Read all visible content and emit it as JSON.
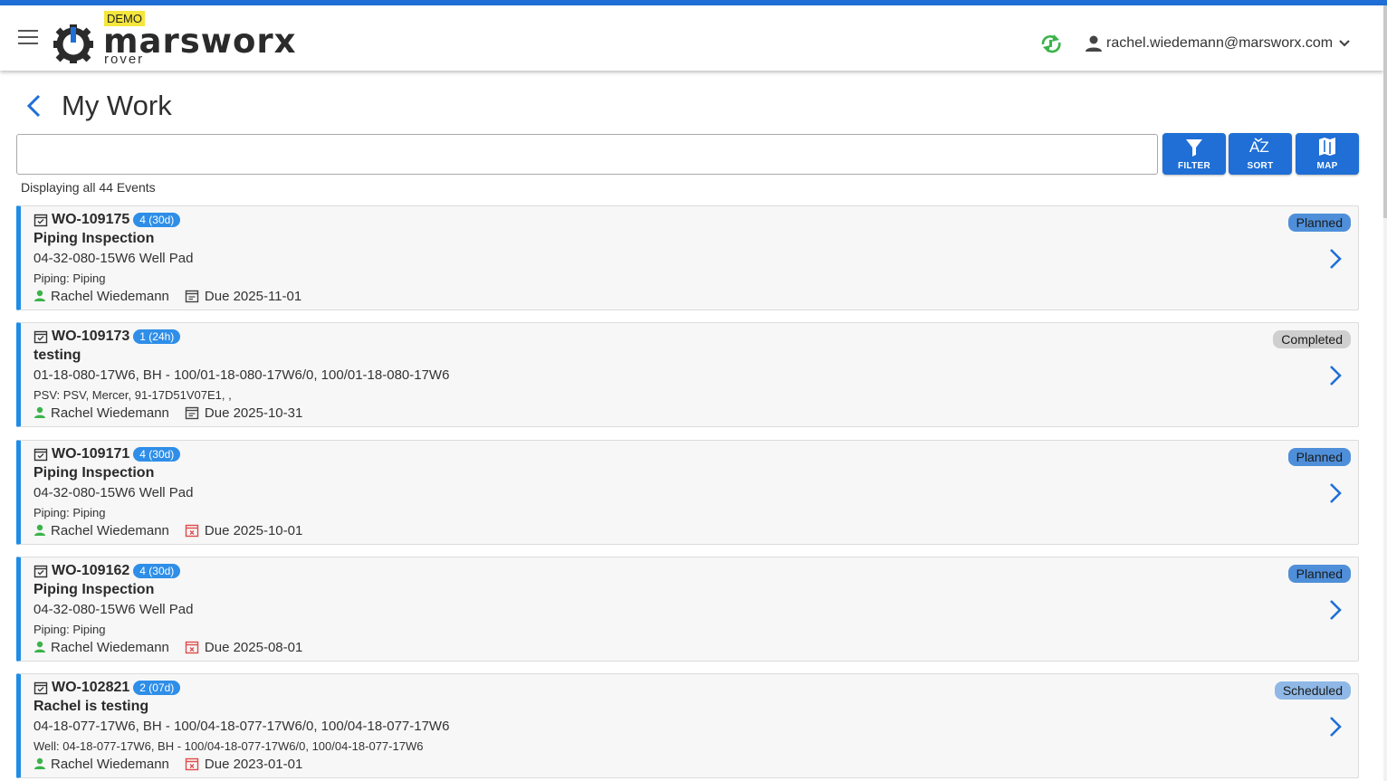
{
  "header": {
    "demo_badge": "DEMO",
    "logo_text": "marsworx",
    "logo_sub": "rover",
    "user_email": "rachel.wiedemann@marsworx.com"
  },
  "page": {
    "title": "My Work",
    "search_placeholder": "",
    "event_count": "Displaying all 44 Events"
  },
  "toolbar": {
    "filter_label": "FILTER",
    "sort_label": "SORT",
    "map_label": "MAP"
  },
  "colors": {
    "accent": "#1f6fd6",
    "card_border": "#1f8de6",
    "planned": "#4f8fd9",
    "completed": "#cfcfcf",
    "scheduled": "#8fb8e6",
    "overdue_icon": "#e04b4b",
    "user_icon": "#3bb34a"
  },
  "work_orders": [
    {
      "id": "WO-109175",
      "pill": "4 (30d)",
      "name": "Piping Inspection",
      "location": "04-32-080-15W6 Well Pad",
      "asset": "Piping: Piping",
      "assignee": "Rachel Wiedemann",
      "due": "Due 2025-11-01",
      "due_icon": "calendar-icon",
      "status": "Planned"
    },
    {
      "id": "WO-109173",
      "pill": "1 (24h)",
      "name": "testing",
      "location": "01-18-080-17W6, BH - 100/01-18-080-17W6/0, 100/01-18-080-17W6",
      "asset": "PSV: PSV, Mercer, 91-17D51V07E1, ,",
      "assignee": "Rachel Wiedemann",
      "due": "Due 2025-10-31",
      "due_icon": "calendar-icon",
      "status": "Completed"
    },
    {
      "id": "WO-109171",
      "pill": "4 (30d)",
      "name": "Piping Inspection",
      "location": "04-32-080-15W6 Well Pad",
      "asset": "Piping: Piping",
      "assignee": "Rachel Wiedemann",
      "due": "Due 2025-10-01",
      "due_icon": "calendar-overdue-icon",
      "status": "Planned"
    },
    {
      "id": "WO-109162",
      "pill": "4 (30d)",
      "name": "Piping Inspection",
      "location": "04-32-080-15W6 Well Pad",
      "asset": "Piping: Piping",
      "assignee": "Rachel Wiedemann",
      "due": "Due 2025-08-01",
      "due_icon": "calendar-overdue-icon",
      "status": "Planned"
    },
    {
      "id": "WO-102821",
      "pill": "2 (07d)",
      "name": "Rachel is testing",
      "location": "04-18-077-17W6, BH - 100/04-18-077-17W6/0, 100/04-18-077-17W6",
      "asset": "Well: 04-18-077-17W6, BH - 100/04-18-077-17W6/0, 100/04-18-077-17W6",
      "assignee": "Rachel Wiedemann",
      "due": "Due 2023-01-01",
      "due_icon": "calendar-overdue-icon",
      "status": "Scheduled"
    }
  ]
}
